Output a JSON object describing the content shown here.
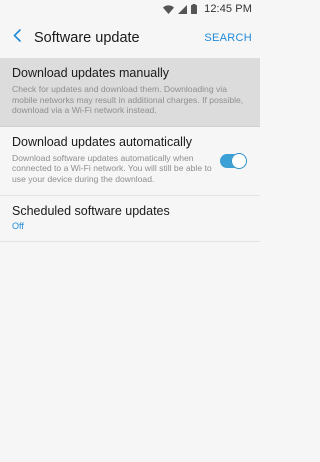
{
  "status_bar": {
    "time": "12:45 PM",
    "icons": [
      "wifi-icon",
      "signal-icon",
      "battery-icon"
    ]
  },
  "app_bar": {
    "title": "Software update",
    "search_label": "SEARCH",
    "back_icon": "chevron-left-icon"
  },
  "settings": {
    "manual": {
      "title": "Download updates manually",
      "description": "Check for updates and download them. Downloading via mobile networks may result in additional charges. If possible, download via a Wi-Fi network instead."
    },
    "auto": {
      "title": "Download updates automatically",
      "description": "Download software updates automatically when connected to a Wi-Fi network. You will still be able to use your device during the download.",
      "enabled": true
    },
    "scheduled": {
      "title": "Scheduled software updates",
      "value": "Off"
    }
  },
  "colors": {
    "accent": "#1f8ad8",
    "toggle_on": "#3aa0d6",
    "highlight_bg": "#dcdcdc",
    "background": "#f6f6f6"
  }
}
